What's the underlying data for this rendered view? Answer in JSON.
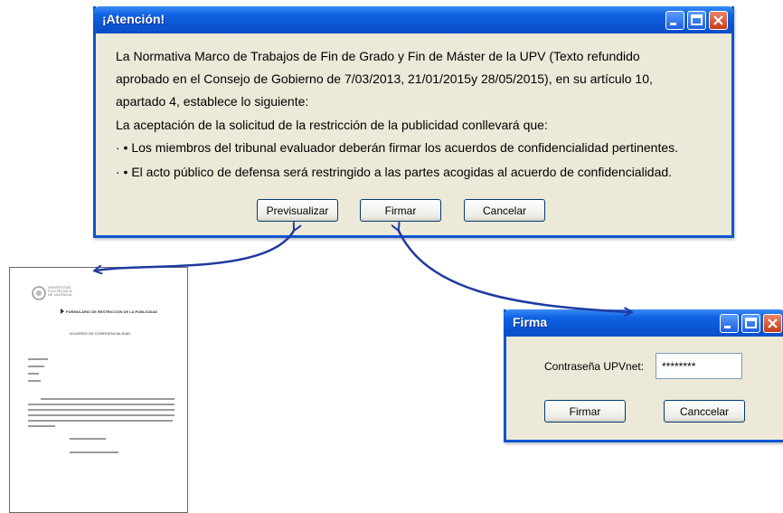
{
  "attention_dialog": {
    "title": "¡Atención!",
    "paragraph_lines": [
      "La Normativa Marco de Trabajos de Fin de Grado y Fin de Máster de la UPV (Texto refundido",
      "aprobado en el Consejo de Gobierno  de 7/03/2013, 21/01/2015y 28/05/2015), en su artículo 10,",
      "apartado 4, establece lo siguiente:"
    ],
    "intro": "La aceptación de la solicitud de la restricción de la publicidad conllevará que:",
    "bullets": [
      "· • Los miembros del tribunal evaluador deberán firmar los acuerdos de confidencialidad pertinentes.",
      "· • El acto público de defensa será restringido a las partes acogidas al acuerdo de confidencialidad."
    ],
    "buttons": {
      "preview": "Previsualizar",
      "sign": "Firmar",
      "cancel": "Cancelar"
    }
  },
  "sign_dialog": {
    "title": "Firma",
    "password_label": "Contraseña UPVnet:",
    "password_value": "********",
    "buttons": {
      "sign": "Firmar",
      "cancel": "Canccelar"
    }
  },
  "preview_document": {
    "logo_text": "UNIVERSITAT POLITÈCNICA DE VALÈNCIA",
    "heading": "FORMULARIO DE RESTRICCIÓN DE LA PUBLICIDAD",
    "subheading": "ACUERDO DE CONFIDENCIALIDAD"
  },
  "colors": {
    "titlebar": "#0a54d2",
    "dialog_bg": "#ece9d8",
    "arrow": "#1f3aa0",
    "close_button": "#c63b17"
  }
}
